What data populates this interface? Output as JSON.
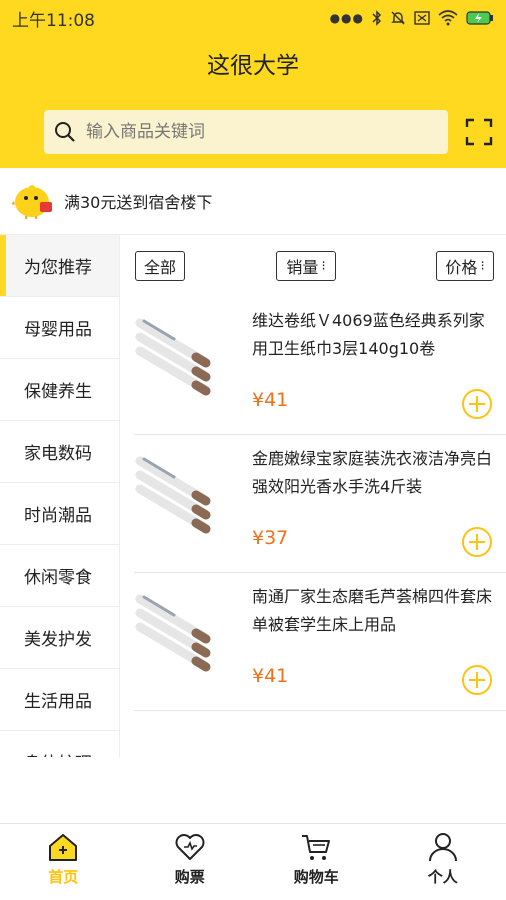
{
  "status": {
    "time": "上午11:08"
  },
  "header": {
    "title": "这很大学"
  },
  "search": {
    "placeholder": "输入商品关键词"
  },
  "promo": {
    "text": "满30元送到宿舍楼下"
  },
  "sidebar": {
    "items": [
      {
        "label": "为您推荐",
        "active": true
      },
      {
        "label": "母婴用品"
      },
      {
        "label": "保健养生"
      },
      {
        "label": "家电数码"
      },
      {
        "label": "时尚潮品"
      },
      {
        "label": "休闲零食"
      },
      {
        "label": "美发护发"
      },
      {
        "label": "生活用品"
      },
      {
        "label": "身体护理"
      }
    ]
  },
  "filters": {
    "all": "全部",
    "sales": "销量",
    "price": "价格"
  },
  "products": [
    {
      "name": "维达卷纸Ｖ4069蓝色经典系列家用卫生纸巾3层140g10卷",
      "price": "¥41"
    },
    {
      "name": "金鹿嫩绿宝家庭装洗衣液洁净亮白强效阳光香水手洗4斤装",
      "price": "¥37"
    },
    {
      "name": "南通厂家生态磨毛芦荟棉四件套床单被套学生床上用品",
      "price": "¥41"
    }
  ],
  "tabbar": {
    "items": [
      {
        "label": "首页",
        "icon": "home-icon",
        "active": true
      },
      {
        "label": "购票",
        "icon": "heart-icon"
      },
      {
        "label": "购物车",
        "icon": "cart-icon"
      },
      {
        "label": "个人",
        "icon": "person-icon"
      }
    ]
  },
  "colors": {
    "brand": "#ffd91f",
    "price": "#f07019",
    "active_tab": "#ffc20e"
  }
}
